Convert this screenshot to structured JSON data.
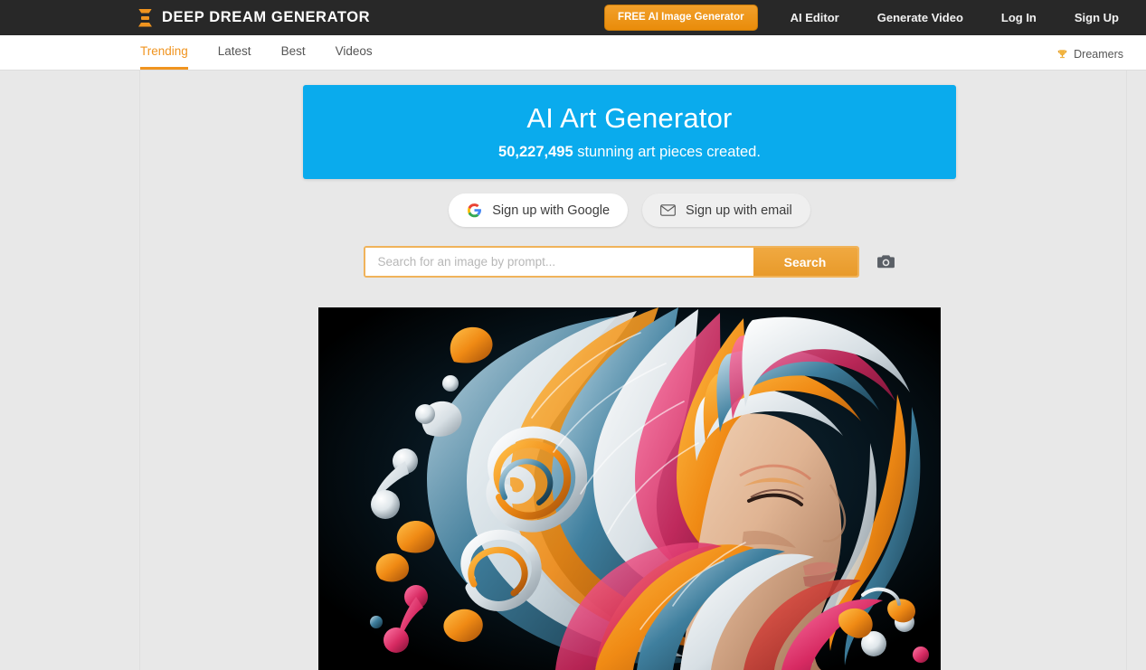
{
  "header": {
    "logo_text": "DEEP DREAM GENERATOR",
    "logo_icon": "hourglass-bars-icon",
    "cta_label": "FREE AI Image Generator",
    "links": [
      {
        "label": "AI Editor"
      },
      {
        "label": "Generate Video"
      },
      {
        "label": "Log In"
      },
      {
        "label": "Sign Up"
      }
    ]
  },
  "tabbar": {
    "tabs": [
      {
        "label": "Trending",
        "active": true
      },
      {
        "label": "Latest",
        "active": false
      },
      {
        "label": "Best",
        "active": false
      },
      {
        "label": "Videos",
        "active": false
      }
    ],
    "dreamers_label": "Dreamers",
    "dreamers_icon": "trophy-icon"
  },
  "hero": {
    "title": "AI Art Generator",
    "count": "50,227,495",
    "subtitle_rest": " stunning art pieces created.",
    "background_color": "#0aabed"
  },
  "signup": {
    "google_label": "Sign up with Google",
    "google_icon": "google-g-icon",
    "email_label": "Sign up with email",
    "email_icon": "envelope-icon"
  },
  "search": {
    "placeholder": "Search for an image by prompt...",
    "value": "",
    "button_label": "Search",
    "camera_icon": "camera-icon"
  },
  "artwork": {
    "alt": "Surreal portrait of a woman's face in profile with flowing multicolored swirling hair on black background",
    "background_color": "#000000"
  },
  "theme": {
    "accent_orange": "#f0941f",
    "header_dark": "#282828",
    "page_background": "#e8e8e8",
    "hero_blue": "#0aabed"
  }
}
